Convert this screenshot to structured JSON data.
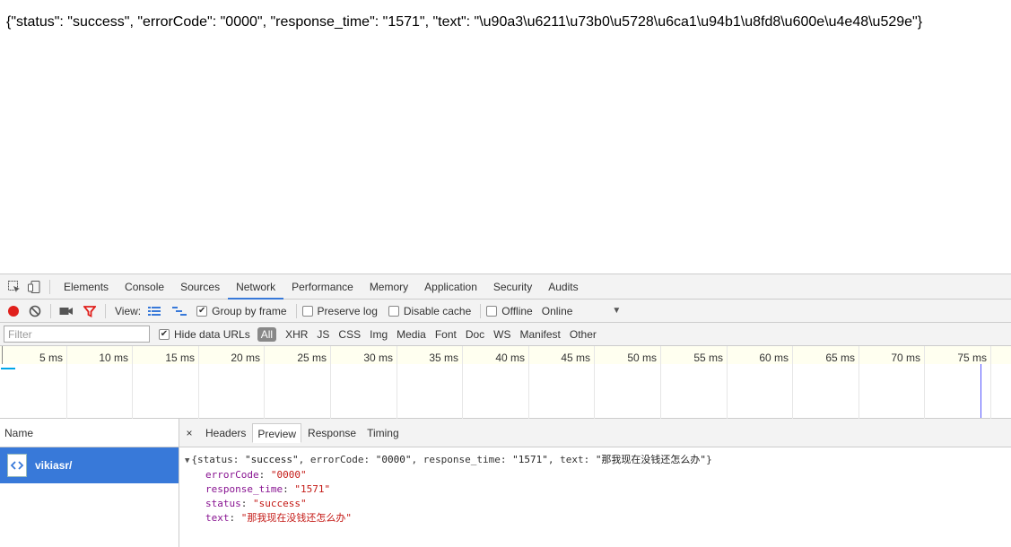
{
  "page": {
    "raw_json": "{\"status\": \"success\", \"errorCode\": \"0000\", \"response_time\": \"1571\", \"text\": \"\\u90a3\\u6211\\u73b0\\u5728\\u6ca1\\u94b1\\u8fd8\\u600e\\u4e48\\u529e\"}"
  },
  "devtools": {
    "tabs": [
      "Elements",
      "Console",
      "Sources",
      "Network",
      "Performance",
      "Memory",
      "Application",
      "Security",
      "Audits"
    ],
    "active_tab": "Network",
    "toolbar": {
      "view_label": "View:",
      "group_by_frame": "Group by frame",
      "preserve_log": "Preserve log",
      "disable_cache": "Disable cache",
      "offline": "Offline",
      "throttle_value": "Online"
    },
    "filter": {
      "placeholder": "Filter",
      "hide_data_urls": "Hide data URLs",
      "types": [
        "All",
        "XHR",
        "JS",
        "CSS",
        "Img",
        "Media",
        "Font",
        "Doc",
        "WS",
        "Manifest",
        "Other"
      ]
    },
    "timeline": {
      "ticks": [
        "5 ms",
        "10 ms",
        "15 ms",
        "20 ms",
        "25 ms",
        "30 ms",
        "35 ms",
        "40 ms",
        "45 ms",
        "50 ms",
        "55 ms",
        "60 ms",
        "65 ms",
        "70 ms",
        "75 ms"
      ]
    },
    "requests": {
      "header": "Name",
      "items": [
        {
          "name": "vikiasr/"
        }
      ]
    },
    "detail": {
      "close": "×",
      "tabs": [
        "Headers",
        "Preview",
        "Response",
        "Timing"
      ],
      "active_tab": "Preview",
      "preview": {
        "toggle": "▼",
        "summary_parts": [
          {
            "t": "{",
            "c": "p"
          },
          {
            "t": "status: ",
            "c": "p"
          },
          {
            "t": "\"success\"",
            "c": "s"
          },
          {
            "t": ", errorCode: ",
            "c": "p"
          },
          {
            "t": "\"0000\"",
            "c": "s"
          },
          {
            "t": ", response_time: ",
            "c": "p"
          },
          {
            "t": "\"1571\"",
            "c": "s"
          },
          {
            "t": ", text: ",
            "c": "p"
          },
          {
            "t": "\"那我现在没钱还怎么办\"",
            "c": "s"
          },
          {
            "t": "}",
            "c": "p"
          }
        ],
        "props": [
          {
            "key": "errorCode",
            "value": "\"0000\""
          },
          {
            "key": "response_time",
            "value": "\"1571\""
          },
          {
            "key": "status",
            "value": "\"success\""
          },
          {
            "key": "text",
            "value": "\"那我现在没钱还怎么办\""
          }
        ]
      }
    }
  }
}
